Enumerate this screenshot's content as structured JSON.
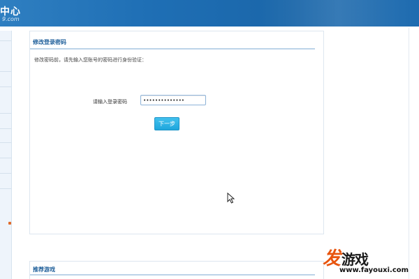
{
  "header": {
    "title": "中心",
    "subtitle": "9.com"
  },
  "main": {
    "section_title": "修改登录密码",
    "instruction": "修改密码前，请先输入您账号的密码进行身份验证：",
    "password_label": "请输入登录密码",
    "password_value": "••••••••••••••",
    "next_button_label": "下一步"
  },
  "bottom": {
    "section_title": "推荐游戏"
  },
  "watermark": {
    "logo_accent": "发",
    "logo_rest": "游戏",
    "url": "www.fayouxi.com"
  },
  "colors": {
    "header_blue": "#1f6fb5",
    "title_blue": "#1f5f9a",
    "button_blue": "#1fa6dc",
    "watermark_orange": "#e8550f"
  },
  "icons": {
    "cursor": "mouse-pointer-icon"
  }
}
